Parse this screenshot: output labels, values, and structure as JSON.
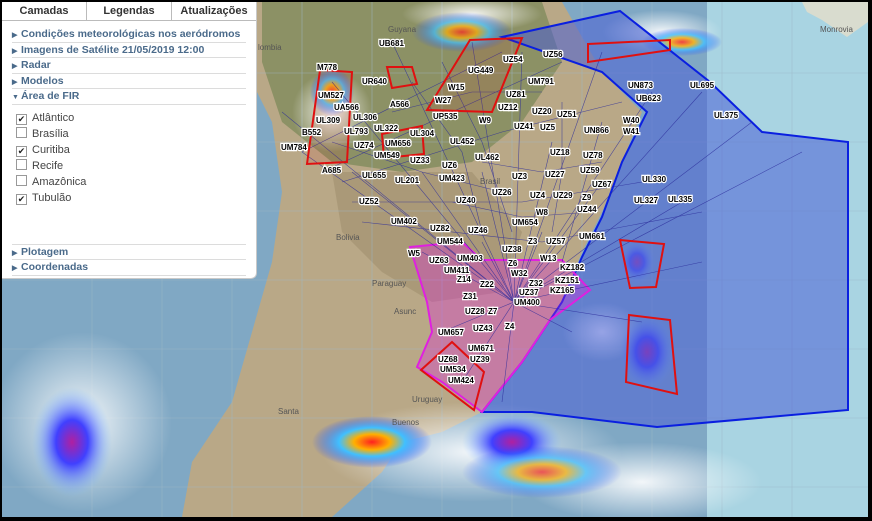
{
  "tabs": [
    "Camadas",
    "Legendas",
    "Atualizações"
  ],
  "sections_top": [
    {
      "label": "Condições meteorológicas nos aeródromos",
      "expanded": false
    },
    {
      "label": "Imagens de Satélite 21/05/2019 12:00",
      "expanded": false
    },
    {
      "label": "Radar",
      "expanded": false
    },
    {
      "label": "Modelos",
      "expanded": false
    },
    {
      "label": "Área de FIR",
      "expanded": true
    }
  ],
  "fir_items": [
    {
      "label": "Atlântico",
      "checked": true
    },
    {
      "label": "Brasília",
      "checked": false
    },
    {
      "label": "Curitiba",
      "checked": true
    },
    {
      "label": "Recife",
      "checked": false
    },
    {
      "label": "Amazônica",
      "checked": false
    },
    {
      "label": "Tubulão",
      "checked": true
    }
  ],
  "sections_bottom": [
    {
      "label": "Plotagem",
      "expanded": false
    },
    {
      "label": "Coordenadas",
      "expanded": false
    }
  ],
  "geo_labels": [
    "Guyana",
    "Bolivia",
    "Paraguay",
    "Uruguay",
    "Buenos",
    "Santa",
    "Monrovia",
    "Brasil",
    "Asunc",
    "lombia"
  ],
  "route_labels": [
    "UB681",
    "M778",
    "UR640",
    "UG449",
    "UZ54",
    "UZ56",
    "UL695",
    "UN873",
    "UB623",
    "UL375",
    "UM527",
    "UA566",
    "UL309",
    "B552",
    "UL793",
    "A566",
    "W15",
    "W27",
    "UZ81",
    "UM791",
    "UZ12",
    "UZ20",
    "UZ51",
    "W40",
    "W41",
    "UN866",
    "UL306",
    "UL322",
    "UL304",
    "UP535",
    "W9",
    "UZ41",
    "UZ5",
    "UL452",
    "UM784",
    "UZ74",
    "UM656",
    "UM549",
    "UZ33",
    "UZ18",
    "UZ78",
    "UL462",
    "A685",
    "UL655",
    "UL201",
    "UM423",
    "UZ6",
    "UZ27",
    "UZ3",
    "UZ59",
    "UZ67",
    "UL330",
    "UZ26",
    "UZ4",
    "UZ29",
    "Z9",
    "UL327",
    "UL335",
    "UZ52",
    "UZ40",
    "UZ44",
    "W8",
    "UM654",
    "UM402",
    "UZ82",
    "UZ46",
    "UM544",
    "UM661",
    "UZ57",
    "Z3",
    "UZ38",
    "W13",
    "W5",
    "UZ63",
    "UM403",
    "Z6",
    "W32",
    "KZ182",
    "UM411",
    "Z14",
    "Z22",
    "Z32",
    "KZ151",
    "KZ165",
    "Z31",
    "UZ37",
    "UM400",
    "UZ28",
    "Z7",
    "UZ43",
    "Z4",
    "UM657",
    "UM671",
    "UZ68",
    "UZ39",
    "UM534",
    "UM424"
  ],
  "colors": {
    "fir_atlantico_fill": "#4a5fd6",
    "fir_atlantico_stroke": "#0a1fe0",
    "fir_curitiba_stroke": "#e020e0",
    "warning_stroke": "#e01010",
    "routes": "#2a2a9a"
  }
}
